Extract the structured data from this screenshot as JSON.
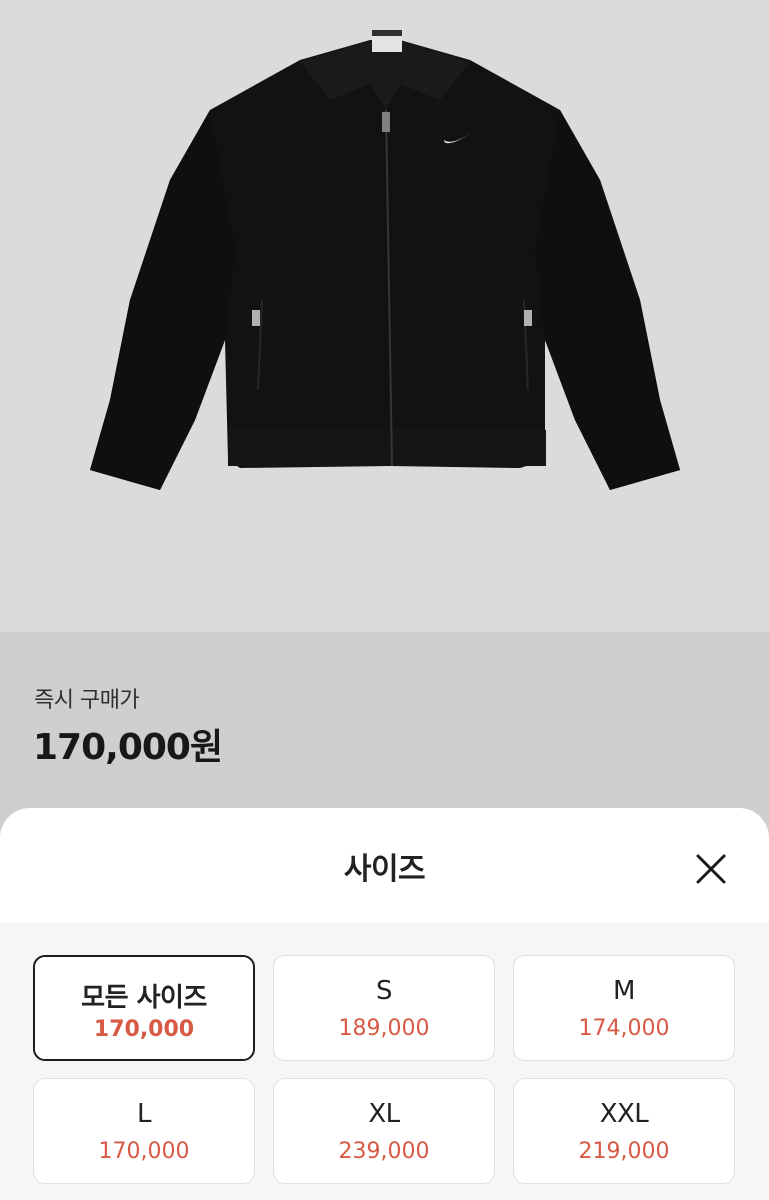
{
  "product": {
    "image_alt": "black zip-up jacket with white swoosh logo"
  },
  "price": {
    "label": "즉시 구매가",
    "value": "170,000원"
  },
  "size_sheet": {
    "title": "사이즈",
    "close_icon": "close-icon",
    "options": [
      {
        "name": "모든 사이즈",
        "price": "170,000",
        "selected": true
      },
      {
        "name": "S",
        "price": "189,000",
        "selected": false
      },
      {
        "name": "M",
        "price": "174,000",
        "selected": false
      },
      {
        "name": "L",
        "price": "170,000",
        "selected": false
      },
      {
        "name": "XL",
        "price": "239,000",
        "selected": false
      },
      {
        "name": "XXL",
        "price": "219,000",
        "selected": false
      }
    ]
  },
  "colors": {
    "price_accent": "#d85a44",
    "selected_border": "#1e1e1e"
  }
}
